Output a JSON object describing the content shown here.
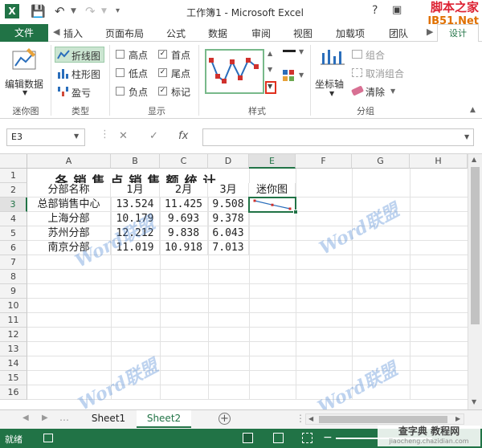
{
  "title_bar": {
    "title": "工作簿1 - Microsoft Excel",
    "help": "?",
    "watermark_line1": "脚本之家",
    "watermark_line2": "JB51.Net"
  },
  "tabs": {
    "file": "文件",
    "items": [
      "插入",
      "页面布局",
      "公式",
      "数据",
      "审阅",
      "视图",
      "加载项",
      "团队"
    ],
    "active": "设计"
  },
  "ribbon": {
    "edit_data": "编辑数据",
    "group_sparkline": "迷你图",
    "type_line": "折线图",
    "type_column": "柱形图",
    "type_winloss": "盈亏",
    "group_type": "类型",
    "show": {
      "high": "高点",
      "first": "首点",
      "low": "低点",
      "last": "尾点",
      "negative": "负点",
      "markers": "标记",
      "first_checked": true,
      "last_checked": true,
      "markers_checked": true
    },
    "group_show": "显示",
    "group_style": "样式",
    "axis": "坐标轴",
    "group": "组合",
    "ungroup": "取消组合",
    "clear": "清除",
    "group_group": "分组",
    "accent_color": "#217346"
  },
  "formula_bar": {
    "name_box": "E3",
    "fx": "fx",
    "formula": ""
  },
  "grid": {
    "columns": [
      "A",
      "B",
      "C",
      "D",
      "E",
      "F",
      "G",
      "H"
    ],
    "rows": [
      "1",
      "2",
      "3",
      "4",
      "5",
      "6",
      "7",
      "8",
      "9",
      "10",
      "11",
      "12",
      "13",
      "14",
      "15",
      "16"
    ],
    "title": "各销售点销售额统计",
    "headers": [
      "分部名称",
      "1月",
      "2月",
      "3月",
      "迷你图"
    ],
    "data": [
      [
        "总部销售中心",
        "13.524",
        "11.425",
        "9.508"
      ],
      [
        "上海分部",
        "10.179",
        "9.693",
        "9.378"
      ],
      [
        "苏州分部",
        "12.212",
        "9.838",
        "6.043"
      ],
      [
        "南京分部",
        "11.019",
        "10.918",
        "7.013"
      ]
    ],
    "selected_cell": "E3"
  },
  "sheets": {
    "tabs": [
      "Sheet1",
      "Sheet2"
    ],
    "active": "Sheet2"
  },
  "status": {
    "ready": "就绪",
    "watermark": "查字典 教程网",
    "watermark_url": "jiaocheng.chazidian.com"
  },
  "watermark_text": "Word联盟"
}
